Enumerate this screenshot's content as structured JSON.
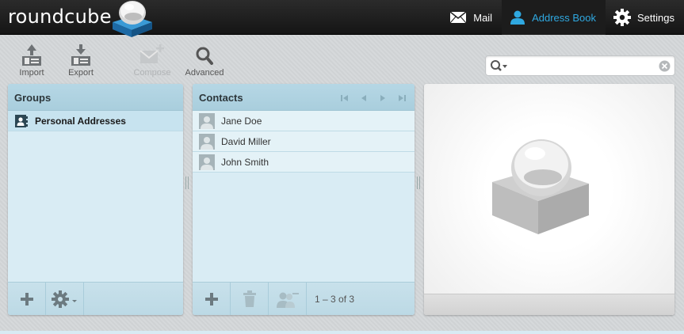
{
  "app": {
    "logo_text": "roundcube"
  },
  "topnav": [
    {
      "label": "Mail",
      "icon": "envelope-icon"
    },
    {
      "label": "Address Book",
      "icon": "contact-icon",
      "active": true
    },
    {
      "label": "Settings",
      "icon": "gear-icon"
    }
  ],
  "toolbar": {
    "import": "Import",
    "export": "Export",
    "compose": "Compose",
    "advanced": "Advanced"
  },
  "search": {
    "value": "",
    "placeholder": ""
  },
  "groups": {
    "title": "Groups",
    "items": [
      {
        "label": "Personal Addresses",
        "selected": true
      }
    ]
  },
  "contacts": {
    "title": "Contacts",
    "items": [
      {
        "name": "Jane Doe"
      },
      {
        "name": "David Miller"
      },
      {
        "name": "John Smith"
      }
    ],
    "count_text": "1 – 3 of 3"
  },
  "colors": {
    "accent": "#2fa8e0",
    "panel_header": "#b6d7e5",
    "panel_body": "#d9ecf4"
  }
}
